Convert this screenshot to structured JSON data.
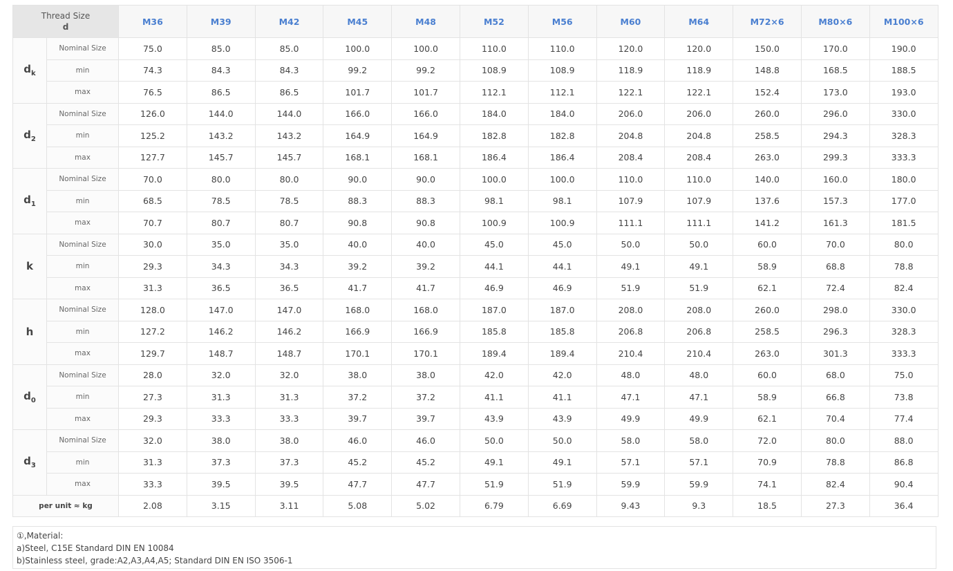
{
  "header": {
    "label_line1": "Thread Size",
    "label_line2": "d",
    "sizes": [
      "M36",
      "M39",
      "M42",
      "M45",
      "M48",
      "M52",
      "M56",
      "M60",
      "M64",
      "M72×6",
      "M80×6",
      "M100×6"
    ]
  },
  "sub_labels": [
    "Nominal Size",
    "min",
    "max"
  ],
  "groups": [
    {
      "symbol": "d",
      "subscript": "k",
      "rows": [
        [
          "75.0",
          "85.0",
          "85.0",
          "100.0",
          "100.0",
          "110.0",
          "110.0",
          "120.0",
          "120.0",
          "150.0",
          "170.0",
          "190.0"
        ],
        [
          "74.3",
          "84.3",
          "84.3",
          "99.2",
          "99.2",
          "108.9",
          "108.9",
          "118.9",
          "118.9",
          "148.8",
          "168.5",
          "188.5"
        ],
        [
          "76.5",
          "86.5",
          "86.5",
          "101.7",
          "101.7",
          "112.1",
          "112.1",
          "122.1",
          "122.1",
          "152.4",
          "173.0",
          "193.0"
        ]
      ]
    },
    {
      "symbol": "d",
      "subscript": "2",
      "rows": [
        [
          "126.0",
          "144.0",
          "144.0",
          "166.0",
          "166.0",
          "184.0",
          "184.0",
          "206.0",
          "206.0",
          "260.0",
          "296.0",
          "330.0"
        ],
        [
          "125.2",
          "143.2",
          "143.2",
          "164.9",
          "164.9",
          "182.8",
          "182.8",
          "204.8",
          "204.8",
          "258.5",
          "294.3",
          "328.3"
        ],
        [
          "127.7",
          "145.7",
          "145.7",
          "168.1",
          "168.1",
          "186.4",
          "186.4",
          "208.4",
          "208.4",
          "263.0",
          "299.3",
          "333.3"
        ]
      ]
    },
    {
      "symbol": "d",
      "subscript": "1",
      "rows": [
        [
          "70.0",
          "80.0",
          "80.0",
          "90.0",
          "90.0",
          "100.0",
          "100.0",
          "110.0",
          "110.0",
          "140.0",
          "160.0",
          "180.0"
        ],
        [
          "68.5",
          "78.5",
          "78.5",
          "88.3",
          "88.3",
          "98.1",
          "98.1",
          "107.9",
          "107.9",
          "137.6",
          "157.3",
          "177.0"
        ],
        [
          "70.7",
          "80.7",
          "80.7",
          "90.8",
          "90.8",
          "100.9",
          "100.9",
          "111.1",
          "111.1",
          "141.2",
          "161.3",
          "181.5"
        ]
      ]
    },
    {
      "symbol": "k",
      "subscript": "",
      "rows": [
        [
          "30.0",
          "35.0",
          "35.0",
          "40.0",
          "40.0",
          "45.0",
          "45.0",
          "50.0",
          "50.0",
          "60.0",
          "70.0",
          "80.0"
        ],
        [
          "29.3",
          "34.3",
          "34.3",
          "39.2",
          "39.2",
          "44.1",
          "44.1",
          "49.1",
          "49.1",
          "58.9",
          "68.8",
          "78.8"
        ],
        [
          "31.3",
          "36.5",
          "36.5",
          "41.7",
          "41.7",
          "46.9",
          "46.9",
          "51.9",
          "51.9",
          "62.1",
          "72.4",
          "82.4"
        ]
      ]
    },
    {
      "symbol": "h",
      "subscript": "",
      "rows": [
        [
          "128.0",
          "147.0",
          "147.0",
          "168.0",
          "168.0",
          "187.0",
          "187.0",
          "208.0",
          "208.0",
          "260.0",
          "298.0",
          "330.0"
        ],
        [
          "127.2",
          "146.2",
          "146.2",
          "166.9",
          "166.9",
          "185.8",
          "185.8",
          "206.8",
          "206.8",
          "258.5",
          "296.3",
          "328.3"
        ],
        [
          "129.7",
          "148.7",
          "148.7",
          "170.1",
          "170.1",
          "189.4",
          "189.4",
          "210.4",
          "210.4",
          "263.0",
          "301.3",
          "333.3"
        ]
      ]
    },
    {
      "symbol": "d",
      "subscript": "0",
      "rows": [
        [
          "28.0",
          "32.0",
          "32.0",
          "38.0",
          "38.0",
          "42.0",
          "42.0",
          "48.0",
          "48.0",
          "60.0",
          "68.0",
          "75.0"
        ],
        [
          "27.3",
          "31.3",
          "31.3",
          "37.2",
          "37.2",
          "41.1",
          "41.1",
          "47.1",
          "47.1",
          "58.9",
          "66.8",
          "73.8"
        ],
        [
          "29.3",
          "33.3",
          "33.3",
          "39.7",
          "39.7",
          "43.9",
          "43.9",
          "49.9",
          "49.9",
          "62.1",
          "70.4",
          "77.4"
        ]
      ]
    },
    {
      "symbol": "d",
      "subscript": "3",
      "rows": [
        [
          "32.0",
          "38.0",
          "38.0",
          "46.0",
          "46.0",
          "50.0",
          "50.0",
          "58.0",
          "58.0",
          "72.0",
          "80.0",
          "88.0"
        ],
        [
          "31.3",
          "37.3",
          "37.3",
          "45.2",
          "45.2",
          "49.1",
          "49.1",
          "57.1",
          "57.1",
          "70.9",
          "78.8",
          "86.8"
        ],
        [
          "33.3",
          "39.5",
          "39.5",
          "47.7",
          "47.7",
          "51.9",
          "51.9",
          "59.9",
          "59.9",
          "74.1",
          "82.4",
          "90.4"
        ]
      ]
    }
  ],
  "weight": {
    "label": "per unit ≈ kg",
    "values": [
      "2.08",
      "3.15",
      "3.11",
      "5.08",
      "5.02",
      "6.79",
      "6.69",
      "9.43",
      "9.3",
      "18.5",
      "27.3",
      "36.4"
    ]
  },
  "notes": {
    "line1": "①,Material:",
    "line2": "a)Steel, C15E Standard DIN EN 10084",
    "line3": "b)Stainless steel, grade:A2,A3,A4,A5;   Standard DIN EN ISO 3506-1"
  }
}
